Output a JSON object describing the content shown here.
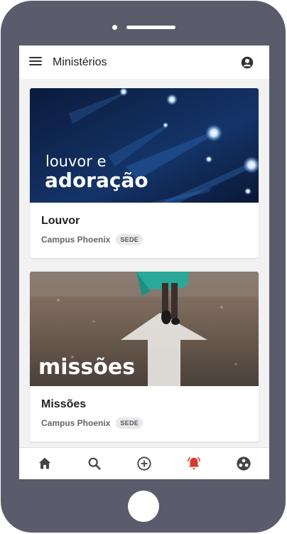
{
  "appbar": {
    "title": "Ministérios",
    "menu_icon": "hamburger-icon",
    "account_icon": "account-circle-icon"
  },
  "cards": [
    {
      "title": "Louvor",
      "campus": "Campus Phoenix",
      "badge": "SEDE",
      "image_text_line1": "louvor e",
      "image_text_line2": "adoração"
    },
    {
      "title": "Missões",
      "campus": "Campus Phoenix",
      "badge": "SEDE",
      "image_text_line1": "missões"
    }
  ],
  "bottom_nav": {
    "items": [
      {
        "icon": "home-icon",
        "active": false
      },
      {
        "icon": "search-icon",
        "active": false
      },
      {
        "icon": "add-circle-icon",
        "active": false
      },
      {
        "icon": "bell-ringing-icon",
        "active": true
      },
      {
        "icon": "community-icon",
        "active": false
      }
    ]
  },
  "colors": {
    "phone_frame": "#5a5b6b",
    "screen_bg": "#f2f2f3",
    "active_nav": "#d83a2a",
    "inactive_nav": "#444444"
  }
}
